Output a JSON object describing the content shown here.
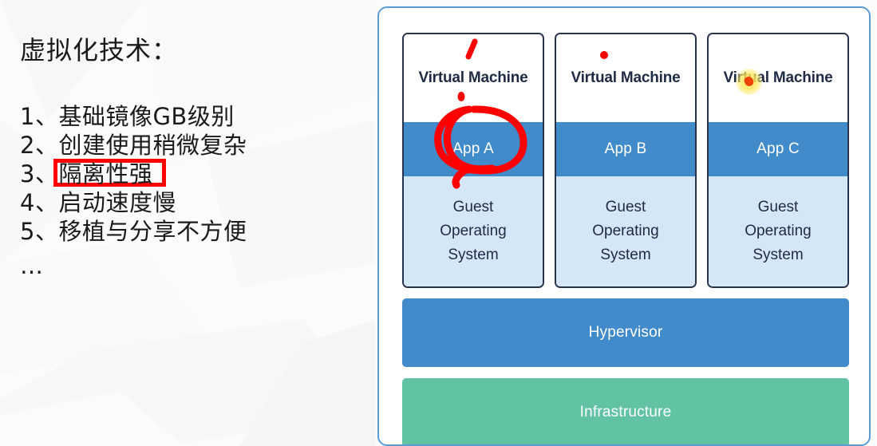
{
  "slide": {
    "title": "虚拟化技术：",
    "ellipsis": "…"
  },
  "list": {
    "items": [
      {
        "number": "1、",
        "text": "基础镜像GB级别",
        "highlighted": false
      },
      {
        "number": "2、",
        "text": "创建使用稍微复杂",
        "highlighted": false
      },
      {
        "number": "3、",
        "text": "隔离性强",
        "highlighted": true
      },
      {
        "number": "4、",
        "text": "启动速度慢",
        "highlighted": false
      },
      {
        "number": "5、",
        "text": "移植与分享不方便",
        "highlighted": false
      }
    ]
  },
  "diagram": {
    "vms": [
      {
        "title": "Virtual Machine",
        "app": "App A",
        "guest": "Guest\nOperating\nSystem"
      },
      {
        "title": "Virtual Machine",
        "app": "App B",
        "guest": "Guest\nOperating\nSystem"
      },
      {
        "title": "Virtual Machine",
        "app": "App C",
        "guest": "Guest\nOperating\nSystem"
      }
    ],
    "hypervisor": "Hypervisor",
    "infrastructure": "Infrastructure"
  },
  "colors": {
    "app_band": "#428bca",
    "guest_os": "#d5e6f7",
    "hypervisor": "#428bca",
    "infrastructure": "#62c3a4",
    "vm_border": "#26344d",
    "container_border": "#5b9bd5",
    "annotation_red": "#fe0000",
    "cursor_dot": "#ee4409",
    "cursor_halo": "#ffe85c"
  },
  "annotations": {
    "highlight_box_label": "隔离性强",
    "circle_target": "App A",
    "tick_mark": "red-stroke-above-virtual-machine",
    "dot_marks": 2
  },
  "cursor": {
    "label": "click-indicator"
  }
}
